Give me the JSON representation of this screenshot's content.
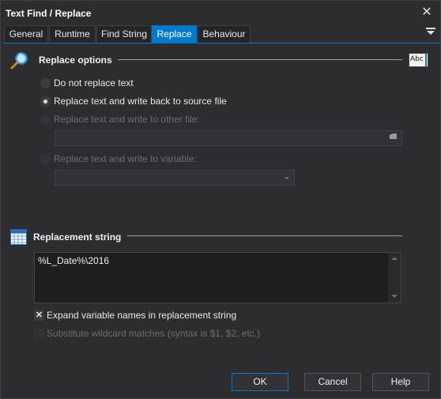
{
  "window": {
    "title": "Text Find / Replace",
    "close_glyph": "✕"
  },
  "tabs": [
    {
      "label": "General",
      "active": false
    },
    {
      "label": "Runtime",
      "active": false
    },
    {
      "label": "Find String",
      "active": false
    },
    {
      "label": "Replace",
      "active": true
    },
    {
      "label": "Behaviour",
      "active": false
    }
  ],
  "replace_options": {
    "heading": "Replace options",
    "icon": "magnifier-search-icon",
    "spellcheck_icon": "abc-text-icon",
    "spellcheck_text": "Abc",
    "options": [
      {
        "label": "Do not replace text",
        "selected": false,
        "enabled": true
      },
      {
        "label": "Replace text and write back to source file",
        "selected": true,
        "enabled": true
      },
      {
        "label": "Replace text and write to other file:",
        "selected": false,
        "enabled": false
      },
      {
        "label": "Replace text and write to variable:",
        "selected": false,
        "enabled": false
      }
    ],
    "other_file_value": "",
    "variable_value": ""
  },
  "replacement_string": {
    "heading": "Replacement string",
    "icon": "calendar-grid-icon",
    "value": "%L_Date%\\2016"
  },
  "checkboxes": [
    {
      "label": "Expand variable names in replacement string",
      "checked": true,
      "enabled": true
    },
    {
      "label": "Substitute wildcard matches (syntax is $1, $2, etc.)",
      "checked": false,
      "enabled": false
    }
  ],
  "buttons": {
    "ok": "OK",
    "cancel": "Cancel",
    "help": "Help"
  },
  "colors": {
    "accent": "#007acc",
    "background": "#2d2d30",
    "disabled_text": "#6d6d6d"
  }
}
